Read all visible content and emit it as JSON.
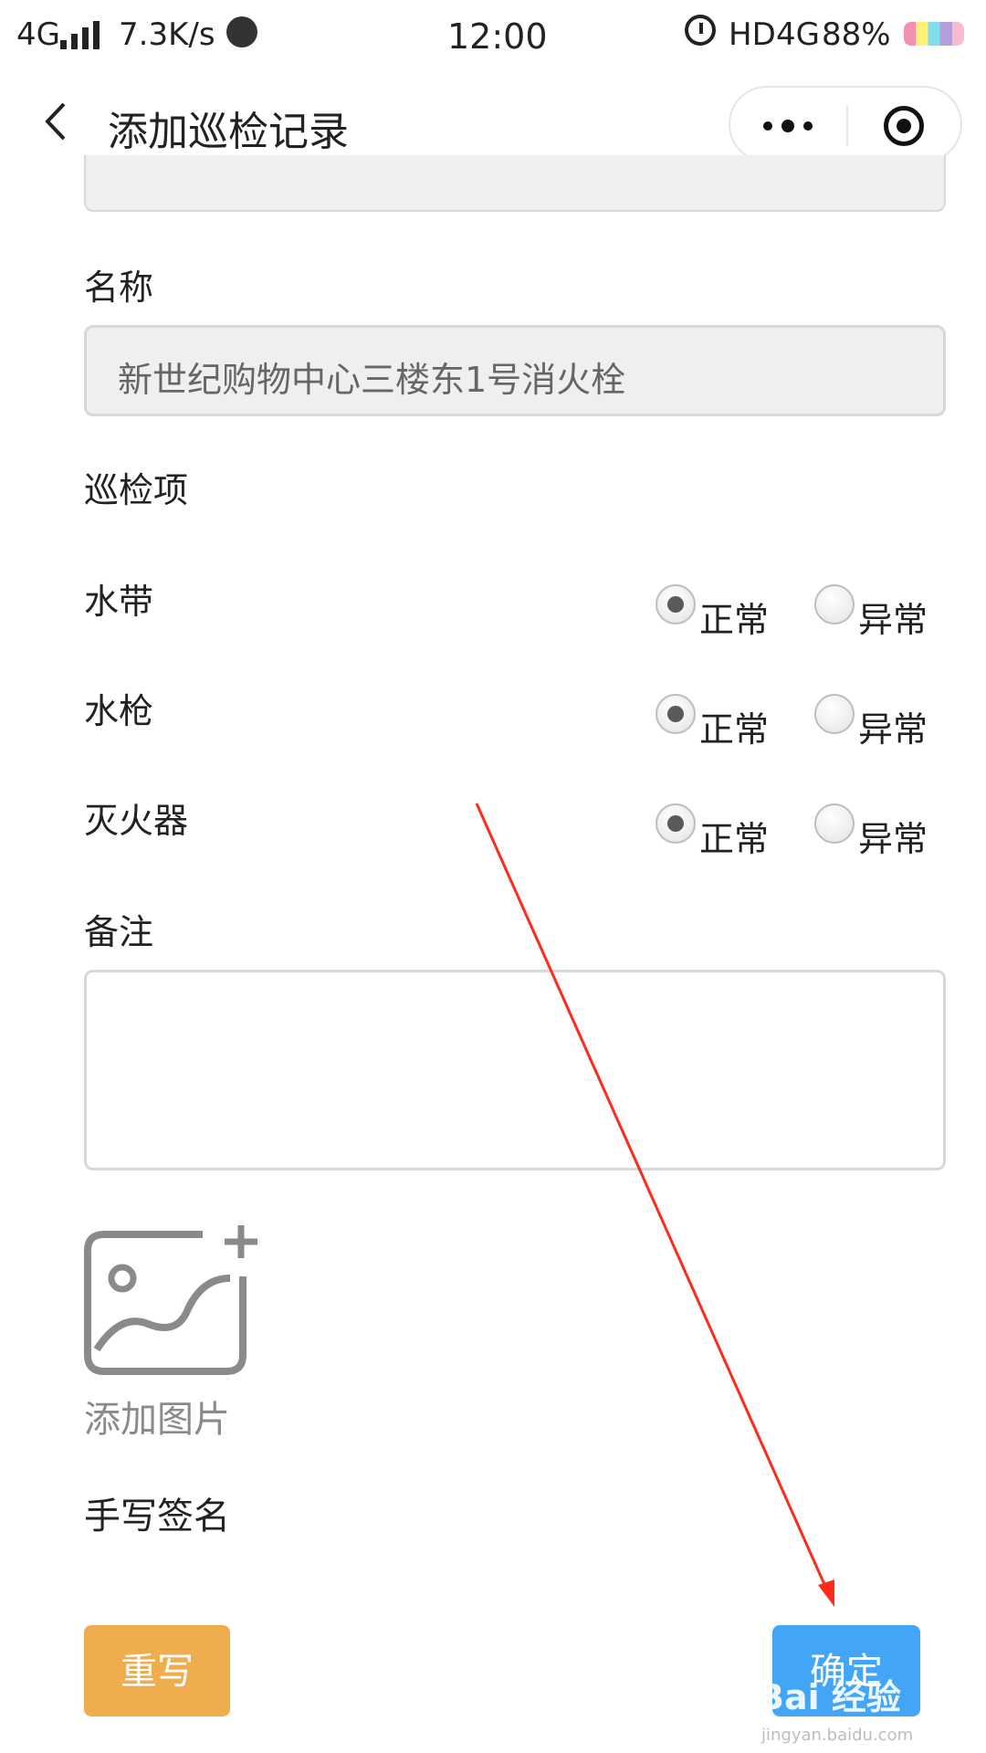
{
  "status_bar": {
    "network": "4G",
    "speed": "7.3K/s",
    "time": "12:00",
    "hd": "HD",
    "network2": "4G",
    "battery": "88%"
  },
  "nav": {
    "title": "添加巡检记录",
    "back_icon": "back-chevron-icon",
    "more_icon": "more-dots-icon",
    "close_icon": "target-circle-icon"
  },
  "form": {
    "name_label": "名称",
    "name_value": "新世纪购物中心三楼东1号消火栓",
    "items_label": "巡检项",
    "items": [
      {
        "label": "水带",
        "selected": "正常"
      },
      {
        "label": "水枪",
        "selected": "正常"
      },
      {
        "label": "灭火器",
        "selected": "正常"
      }
    ],
    "option_normal": "正常",
    "option_abnormal": "异常",
    "remark_label": "备注",
    "remark_value": "",
    "add_image_label": "添加图片",
    "signature_label": "手写签名"
  },
  "buttons": {
    "reset": "重写",
    "confirm": "确定"
  },
  "watermark": {
    "brand": "Bai 经验",
    "url": "jingyan.baidu.com"
  },
  "colors": {
    "reset_button": "#f0ad4e",
    "confirm_button": "#42a5f5",
    "annotation_arrow": "#ff2a1a"
  }
}
